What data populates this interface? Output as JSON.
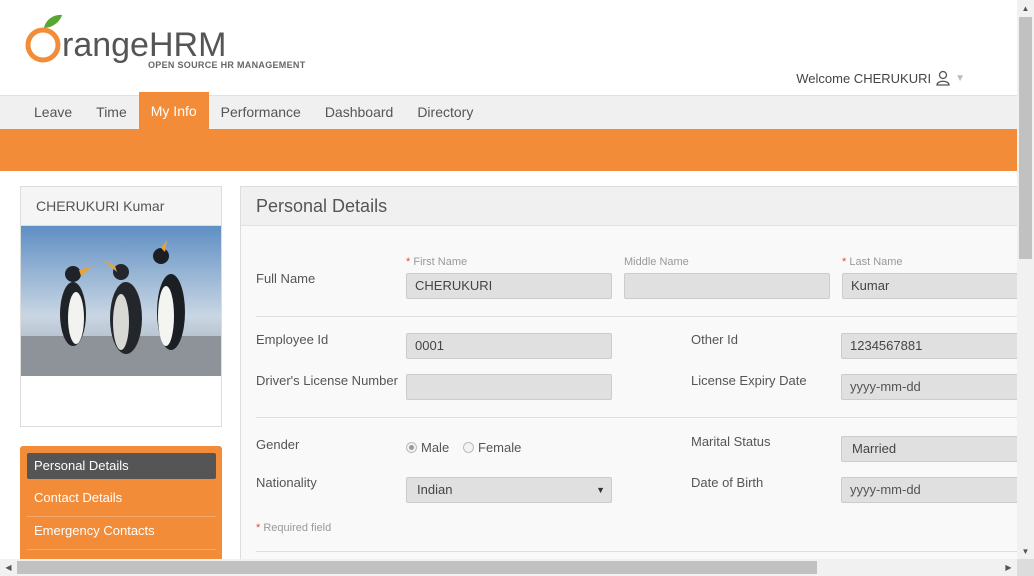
{
  "header": {
    "logo_word": "rangeHRM",
    "logo_tagline": "OPEN SOURCE HR MANAGEMENT",
    "welcome": "Welcome CHERUKURI"
  },
  "nav": {
    "items": [
      "Leave",
      "Time",
      "My Info",
      "Performance",
      "Dashboard",
      "Directory"
    ],
    "active": "My Info"
  },
  "profile": {
    "name": "CHERUKURI Kumar"
  },
  "side_menu": {
    "items": [
      "Personal Details",
      "Contact Details",
      "Emergency Contacts"
    ]
  },
  "personal_details": {
    "title": "Personal Details",
    "full_name_label": "Full Name",
    "first_name_label": "First Name",
    "middle_name_label": "Middle Name",
    "last_name_label": "Last Name",
    "required_star": "*",
    "first_name": "CHERUKURI",
    "middle_name": "",
    "last_name": "Kumar",
    "employee_id_label": "Employee Id",
    "employee_id": "0001",
    "other_id_label": "Other Id",
    "other_id": "1234567881",
    "license_label": "Driver's License Number",
    "license": "",
    "license_expiry_label": "License Expiry Date",
    "license_expiry_placeholder": "yyyy-mm-dd",
    "gender_label": "Gender",
    "gender_male": "Male",
    "gender_female": "Female",
    "gender_selected": "Male",
    "marital_label": "Marital Status",
    "marital": "Married",
    "nationality_label": "Nationality",
    "nationality": "Indian",
    "dob_label": "Date of Birth",
    "dob_placeholder": "yyyy-mm-dd",
    "required_note": "Required field"
  },
  "colors": {
    "accent": "#f28c38",
    "side_active": "#555555"
  }
}
